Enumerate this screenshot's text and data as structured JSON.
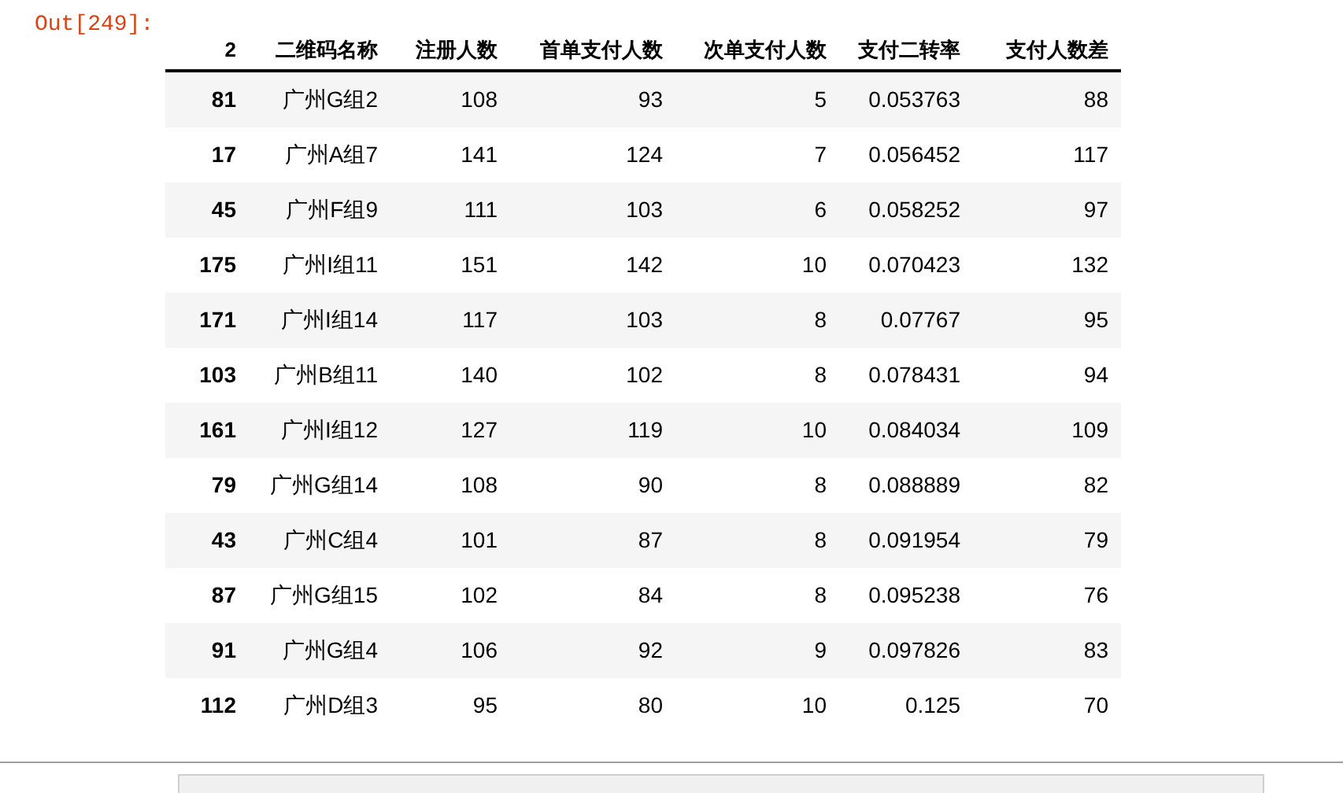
{
  "output_prompt": "Out[249]:",
  "table": {
    "columns": [
      "2",
      "二维码名称",
      "注册人数",
      "首单支付人数",
      "次单支付人数",
      "支付二转率",
      "支付人数差"
    ],
    "rows": [
      {
        "cells": [
          "81",
          "广州G组2",
          "108",
          "93",
          "5",
          "0.053763",
          "88"
        ]
      },
      {
        "cells": [
          "17",
          "广州A组7",
          "141",
          "124",
          "7",
          "0.056452",
          "117"
        ]
      },
      {
        "cells": [
          "45",
          "广州F组9",
          "111",
          "103",
          "6",
          "0.058252",
          "97"
        ]
      },
      {
        "cells": [
          "175",
          "广州I组11",
          "151",
          "142",
          "10",
          "0.070423",
          "132"
        ]
      },
      {
        "cells": [
          "171",
          "广州I组14",
          "117",
          "103",
          "8",
          "0.07767",
          "95"
        ]
      },
      {
        "cells": [
          "103",
          "广州B组11",
          "140",
          "102",
          "8",
          "0.078431",
          "94"
        ]
      },
      {
        "cells": [
          "161",
          "广州I组12",
          "127",
          "119",
          "10",
          "0.084034",
          "109"
        ]
      },
      {
        "cells": [
          "79",
          "广州G组14",
          "108",
          "90",
          "8",
          "0.088889",
          "82"
        ]
      },
      {
        "cells": [
          "43",
          "广州C组4",
          "101",
          "87",
          "8",
          "0.091954",
          "79"
        ]
      },
      {
        "cells": [
          "87",
          "广州G组15",
          "102",
          "84",
          "8",
          "0.095238",
          "76"
        ]
      },
      {
        "cells": [
          "91",
          "广州G组4",
          "106",
          "92",
          "9",
          "0.097826",
          "83"
        ]
      },
      {
        "cells": [
          "112",
          "广州D组3",
          "95",
          "80",
          "10",
          "0.125",
          "70"
        ]
      }
    ]
  }
}
